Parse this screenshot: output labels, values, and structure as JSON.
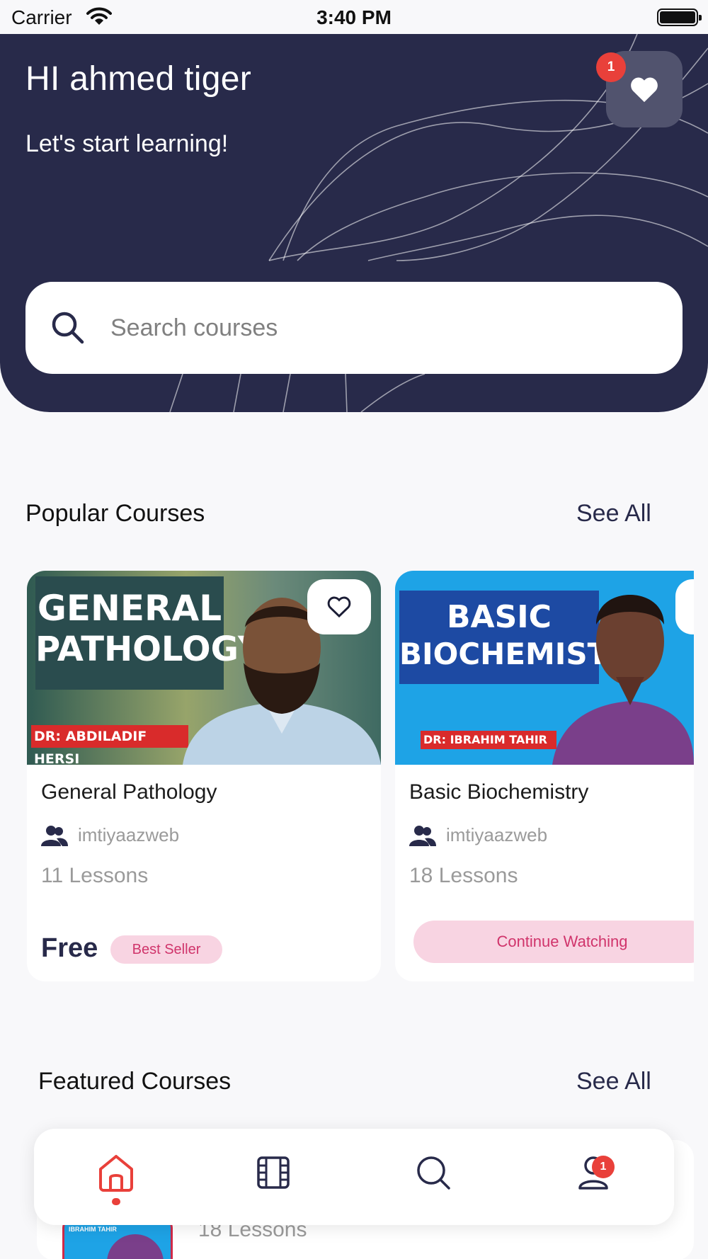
{
  "status_bar": {
    "carrier": "Carrier",
    "time": "3:40 PM"
  },
  "header": {
    "greeting": "HI ahmed tiger",
    "subtitle": "Let's start learning!",
    "favorites_badge": "1"
  },
  "search": {
    "placeholder": "Search courses",
    "value": ""
  },
  "popular": {
    "title": "Popular Courses",
    "see_all": "See All",
    "courses": [
      {
        "thumb_title_line1": "GENERAL",
        "thumb_title_line2": "PATHOLOGY",
        "thumb_doctor": "DR: ABDILADIF HERSI",
        "title": "General Pathology",
        "author": "imtiyaazweb",
        "lessons": "11 Lessons",
        "price": "Free",
        "badge": "Best Seller"
      },
      {
        "thumb_title_line1": "BASIC",
        "thumb_title_line2": "BIOCHEMISTRY",
        "thumb_doctor": "DR: IBRAHIM TAHIR",
        "title": "Basic Biochemistry",
        "author": "imtiyaazweb",
        "lessons": "18 Lessons",
        "action": "Continue Watching"
      }
    ]
  },
  "featured": {
    "title": "Featured Courses",
    "see_all": "See All",
    "peek_thumb_doctor": "IBRAHIM TAHIR",
    "peek_lessons": "18 Lessons"
  },
  "bottom_nav": {
    "items": [
      {
        "icon": "home-icon",
        "active": true
      },
      {
        "icon": "film-icon",
        "active": false
      },
      {
        "icon": "search-icon",
        "active": false
      },
      {
        "icon": "profile-icon",
        "active": false
      }
    ],
    "profile_badge": "1"
  },
  "colors": {
    "primary": "#282a4a",
    "accent": "#e9403a",
    "pink_bg": "#f8d4e2",
    "pink_text": "#d0346b"
  }
}
